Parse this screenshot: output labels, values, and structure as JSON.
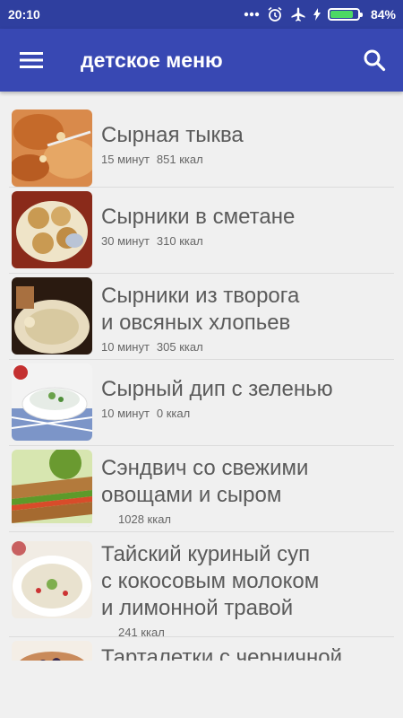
{
  "status": {
    "time": "20:10",
    "battery": "84%",
    "battery_level": 0.84
  },
  "appbar": {
    "title": "детское меню",
    "menu_icon": "hamburger-menu-icon",
    "search_icon": "search-icon"
  },
  "recipes": [
    {
      "title": "Сырная тыква",
      "time": "15 минут",
      "kcal": "851 ккал"
    },
    {
      "title": "Сырники в сметане",
      "time": "30 минут",
      "kcal": "310 ккал"
    },
    {
      "title": "Сырники из творога\nи овсяных хлопьев",
      "time": "10 минут",
      "kcal": "305 ккал"
    },
    {
      "title": "Сырный дип с зеленью",
      "time": "10 минут",
      "kcal": "0 ккал"
    },
    {
      "title": "Сэндвич со свежими\nовощами и сыром",
      "time": "",
      "kcal": "1028 ккал"
    },
    {
      "title": "Тайский куриный суп\nс кокосовым молоком\nи лимонной травой",
      "time": "",
      "kcal": "241 ккал"
    },
    {
      "title": "Тарталетки с черничной",
      "time": "",
      "kcal": ""
    }
  ]
}
